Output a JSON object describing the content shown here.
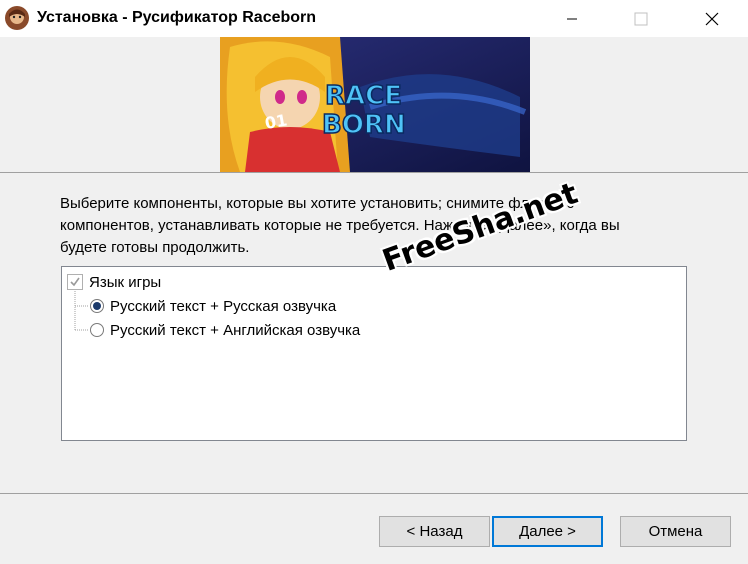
{
  "window": {
    "title": "Установка - Русификатор Raceborn",
    "app_icon": "avatar-icon",
    "controls": [
      "minimize-icon",
      "maximize-icon",
      "close-icon"
    ]
  },
  "banner": {
    "logo_line1": "RACE",
    "logo_line2": "BORN",
    "jersey_number": "01"
  },
  "description": {
    "line1": "Выберите компоненты, которые вы хотите установить; снимите флажки с",
    "line2": "компонентов, устанавливать которые не требуется. Нажмите «Далее», когда вы",
    "line3": "будете готовы продолжить."
  },
  "components": {
    "group_label": "Язык игры",
    "group_checked": true,
    "options": [
      {
        "label": "Русский текст + Русская озвучка",
        "selected": true
      },
      {
        "label": "Русский текст + Английская озвучка",
        "selected": false
      }
    ]
  },
  "watermark": "FreeSha.net",
  "buttons": {
    "back": "< Назад",
    "next": "Далее >",
    "cancel": "Отмена"
  },
  "colors": {
    "accent": "#0078d7",
    "banner_bg": "#1a1f5a",
    "logo": "#4fc3f7"
  }
}
